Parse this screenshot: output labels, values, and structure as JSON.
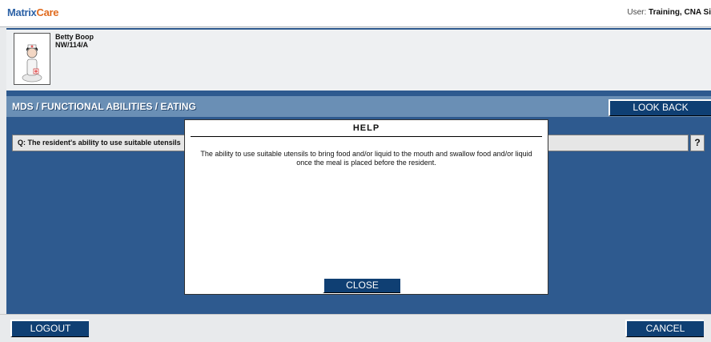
{
  "app": {
    "logo_part1": "Matrix",
    "logo_part2": "Care",
    "user_label": "User:",
    "user_name": "Training, CNA Si"
  },
  "resident": {
    "name": "Betty Boop",
    "room": "NW/114/A"
  },
  "page": {
    "title": "MDS / FUNCTIONAL ABILITIES / EATING",
    "look_back_label": "LOOK BACK"
  },
  "question": {
    "text": "Q: The resident's ability to use suitable utensils",
    "help_label": "?"
  },
  "help_dialog": {
    "title": "HELP",
    "body": "The ability to use suitable utensils to bring food and/or liquid to the mouth and swallow food and/or liquid once the meal is placed before the resident.",
    "close_label": "CLOSE"
  },
  "footer": {
    "logout_label": "LOGOUT",
    "cancel_label": "CANCEL"
  },
  "colors": {
    "brand_blue": "#2d62a6",
    "brand_orange": "#e06b1f",
    "frame_blue": "#2e5a8f",
    "title_blue": "#6a8fb5",
    "button_navy": "#0f3f73"
  }
}
